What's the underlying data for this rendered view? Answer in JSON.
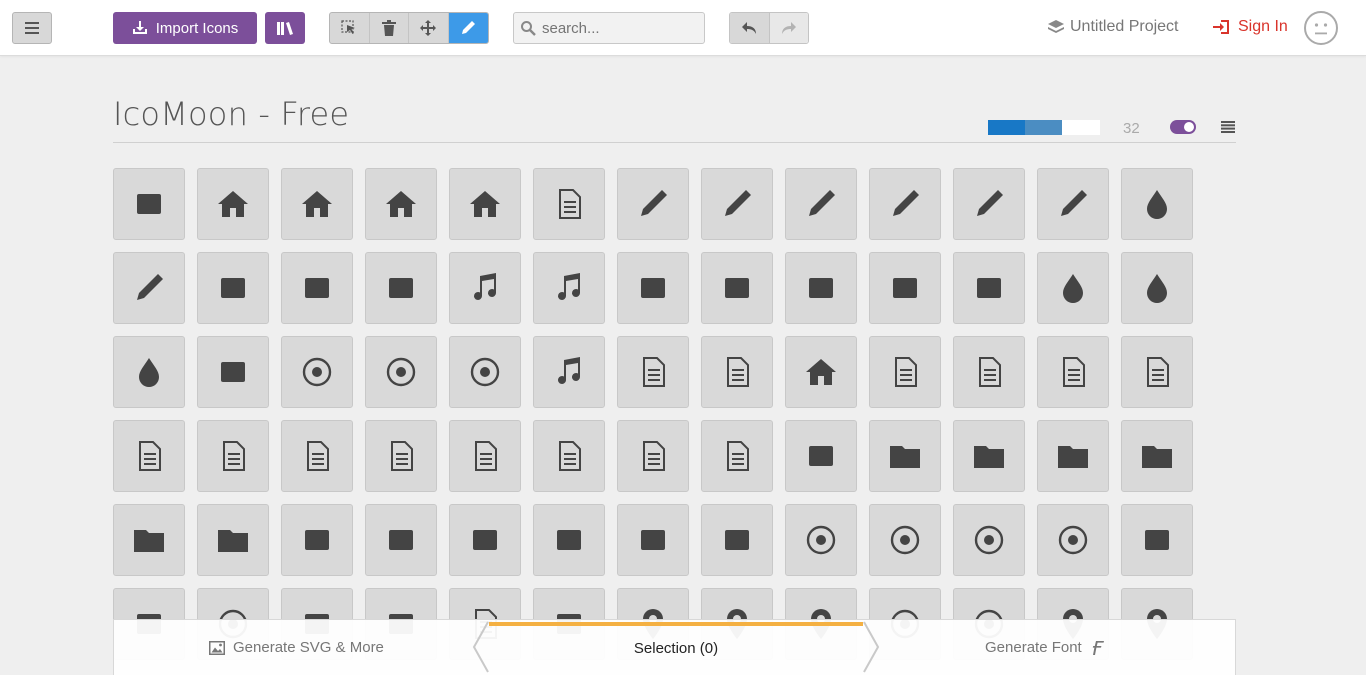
{
  "toolbar": {
    "import_label": "Import Icons",
    "search_placeholder": "search...",
    "project_label": "Untitled Project",
    "signin_label": "Sign In",
    "tools": [
      "select-icon",
      "trash-icon",
      "move-icon",
      "pencil-icon"
    ],
    "active_tool": "pencil-icon"
  },
  "set": {
    "title": "IcoMoon - Free",
    "size": "32",
    "toggle_on": true
  },
  "icons": [
    "turtle",
    "home",
    "home2",
    "home3",
    "office",
    "newspaper",
    "pencil",
    "pencil2",
    "quill",
    "pen",
    "blog",
    "eyedropper",
    "droplet",
    "paint-format",
    "image",
    "images",
    "camera",
    "headphones",
    "music",
    "play",
    "film",
    "video-camera",
    "dice",
    "pacman",
    "spades",
    "clubs",
    "diamonds",
    "bullhorn",
    "connection",
    "podcast",
    "feed",
    "mic",
    "book",
    "books",
    "library",
    "file-text",
    "profile",
    "file-empty",
    "files-empty",
    "file-text2",
    "file-picture",
    "file-music",
    "file-play",
    "file-video",
    "file-zip",
    "copy",
    "paste",
    "stack",
    "folder",
    "folder-open",
    "folder-plus",
    "folder-minus",
    "folder-download",
    "folder-upload",
    "price-tag",
    "price-tags",
    "barcode",
    "qrcode",
    "ticket",
    "cart",
    "coin-dollar",
    "coin-euro",
    "coin-pound",
    "coin-yen",
    "credit-card",
    "calculator",
    "lifebuoy",
    "phone",
    "phone-hang-up",
    "address-book",
    "envelop",
    "pushpin",
    "location",
    "location2",
    "compass",
    "compass2",
    "map",
    "map2"
  ],
  "bottom": {
    "generate_svg": "Generate SVG & More",
    "selection": "Selection (0)",
    "generate_font": "Generate Font"
  },
  "colors": {
    "brand": "#7c4f9a",
    "active_tool": "#3d9ae8",
    "signin": "#d9342b",
    "selection_tab": "#f4b042",
    "icon": "#444444"
  }
}
